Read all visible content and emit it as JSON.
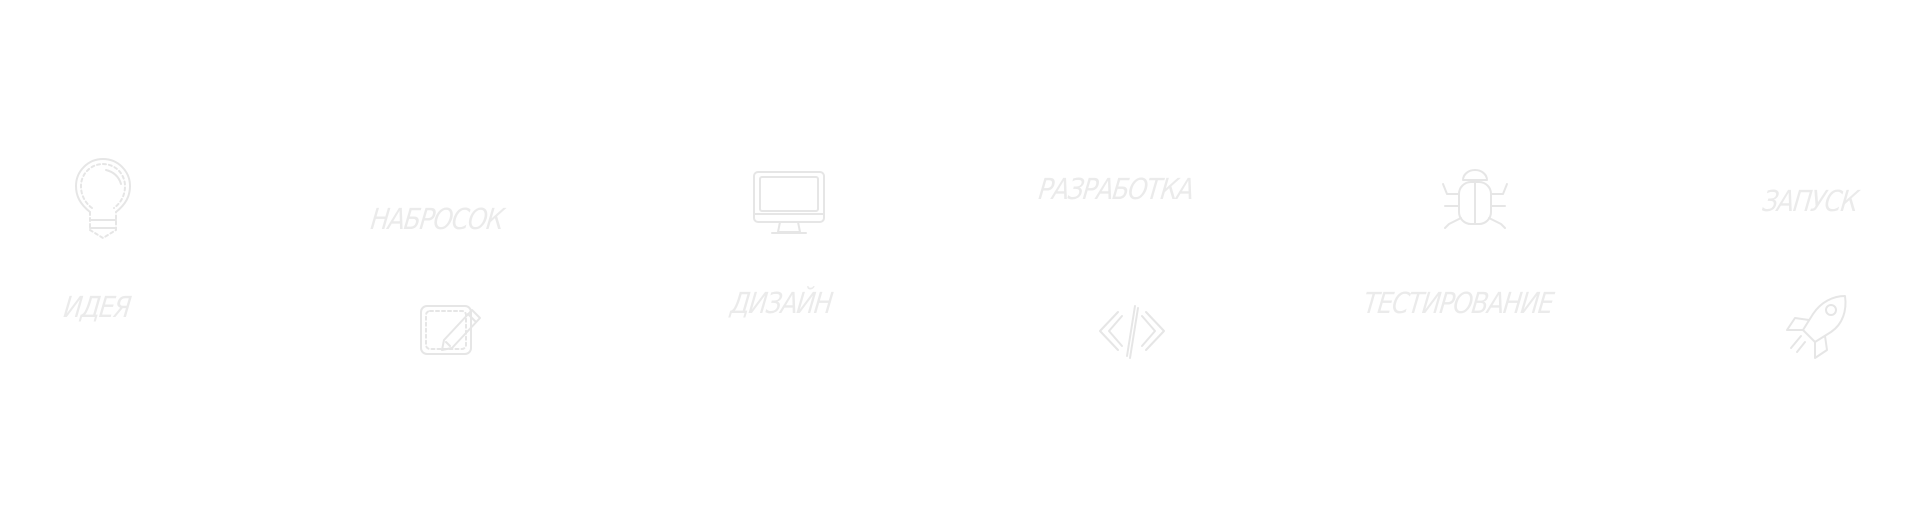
{
  "steps": [
    {
      "label": "ИДЕЯ",
      "icon": "lightbulb-icon"
    },
    {
      "label": "НАБРОСОК",
      "icon": "edit-icon"
    },
    {
      "label": "ДИЗАЙН",
      "icon": "monitor-icon"
    },
    {
      "label": "РАЗРАБОТКА",
      "icon": "code-icon"
    },
    {
      "label": "ТЕСТИРОВАНИЕ",
      "icon": "bug-icon"
    },
    {
      "label": "ЗАПУСК",
      "icon": "rocket-icon"
    }
  ],
  "colors": {
    "background": "#ffffff",
    "icon": "#e6e6e6",
    "text": "#ebebeb"
  }
}
